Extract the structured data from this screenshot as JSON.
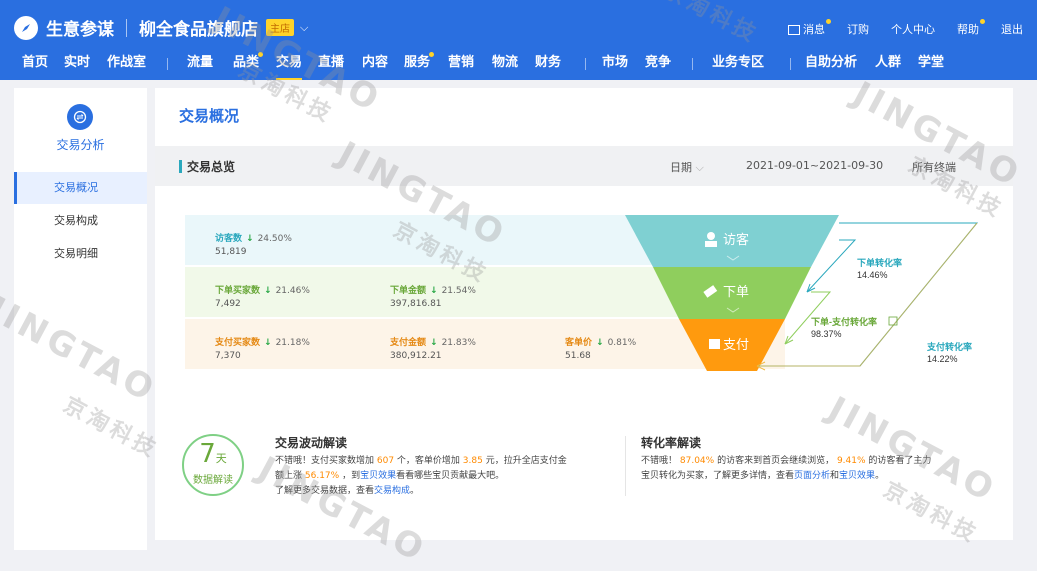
{
  "brand": {
    "name": "生意参谋",
    "shop_name": "柳全食品旗舰店",
    "badge": "主店",
    "chevron": "⌵"
  },
  "top_right": {
    "messages": "消息",
    "subscribe": "订购",
    "personal": "个人中心",
    "help": "帮助",
    "logout": "退出"
  },
  "nav": [
    "首页",
    "实时",
    "作战室",
    "流量",
    "品类",
    "交易",
    "直播",
    "内容",
    "服务",
    "营销",
    "物流",
    "财务",
    "市场",
    "竞争",
    "业务专区",
    "自助分析",
    "人群",
    "学堂"
  ],
  "nav_active": "交易",
  "sidebar": {
    "title": "交易分析",
    "items": [
      "交易概况",
      "交易构成",
      "交易明细"
    ],
    "active": "交易概况"
  },
  "main": {
    "page_title": "交易概况",
    "section_title": "交易总览",
    "filter_date_label": "日期",
    "date_range": "2021-09-01~2021-09-30",
    "terminal": "所有终端"
  },
  "funnel": {
    "rows": [
      {
        "color": "#eaf7fa",
        "metrics": [
          {
            "label": "访客数",
            "change": "24.50%",
            "value": "51,819",
            "color": "#2aa8bd"
          }
        ]
      },
      {
        "color": "#f1f9e9",
        "metrics": [
          {
            "label": "下单买家数",
            "change": "21.46%",
            "value": "7,492",
            "color": "#6aa83a"
          },
          {
            "label": "下单金额",
            "change": "21.54%",
            "value": "397,816.81",
            "color": "#6aa83a"
          }
        ]
      },
      {
        "color": "#fdf4e8",
        "metrics": [
          {
            "label": "支付买家数",
            "change": "21.18%",
            "value": "7,370",
            "color": "#e58a16"
          },
          {
            "label": "支付金额",
            "change": "21.83%",
            "value": "380,912.21",
            "color": "#e58a16"
          },
          {
            "label": "客单价",
            "change": "0.81%",
            "value": "51.68",
            "color": "#e58a16"
          }
        ]
      }
    ],
    "stages": [
      {
        "label": "访客",
        "color": "#7fd0d2"
      },
      {
        "label": "下单",
        "color": "#8fce5d"
      },
      {
        "label": "支付",
        "color": "#ff9a0e"
      }
    ],
    "rates": [
      {
        "label": "下单转化率",
        "value": "14.46%",
        "color": "#2aa8bd"
      },
      {
        "label": "下单-支付转化率",
        "value": "98.37%",
        "color": "#6aa83a"
      },
      {
        "label": "支付转化率",
        "value": "14.22%",
        "color": "#2aa8bd"
      }
    ]
  },
  "interpretation": {
    "badge_num": "7",
    "badge_unit": "天",
    "badge_text": "数据解读",
    "left_title": "交易波动解读",
    "left_lines": [
      {
        "p1": "不错哦！支付买家数增加 ",
        "h1": "607",
        "p2": " 个，客单价增加 ",
        "h2": "3.85",
        "p3": " 元，拉升全店支付金"
      },
      {
        "p1": "额上涨 ",
        "h1": "56.17%",
        "p2": " ，到",
        "link": "宝贝效果",
        "p3": "看看哪些宝贝贡献最大吧。"
      },
      {
        "p1": "了解更多交易数据，查看",
        "link": "交易构成",
        "p2": "。"
      }
    ],
    "right_title": "转化率解读",
    "right_lines": [
      {
        "p1": "不错哦！ ",
        "h1": "87.04%",
        "p2": " 的访客来到首页会继续浏览， ",
        "h2": "9.41%",
        "p3": " 的访客看了主力"
      },
      {
        "p1": "宝贝转化为买家，了解更多详情，查看",
        "link1": "页面分析",
        "p2": "和",
        "link2": "宝贝效果",
        "p3": "。"
      }
    ]
  },
  "watermark": {
    "line1": "JINGTAO",
    "line2": "京淘科技"
  }
}
